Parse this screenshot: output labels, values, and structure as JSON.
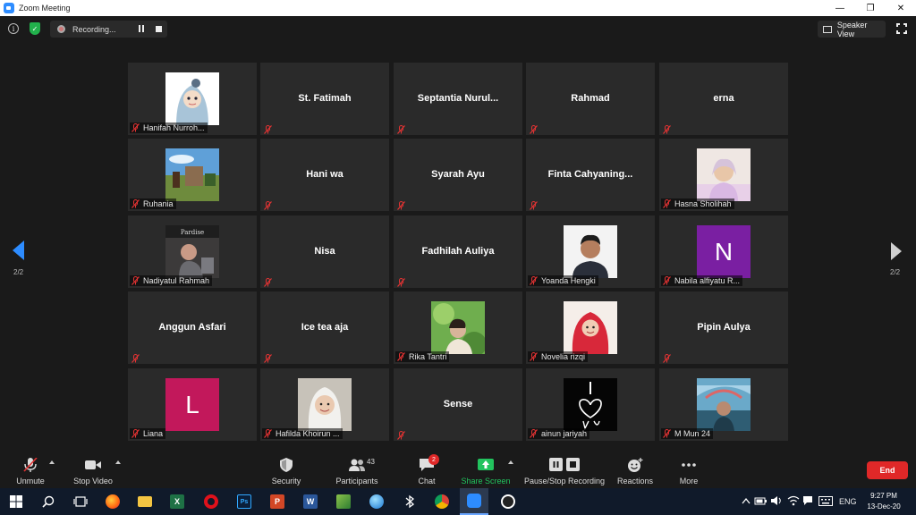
{
  "window": {
    "title": "Zoom Meeting",
    "minimize": "—",
    "restore": "❐",
    "close": "✕"
  },
  "topbar": {
    "info_glyph": "i",
    "recording_label": "Recording...",
    "speaker_view_label": "Speaker View"
  },
  "pagination": {
    "left_label": "2/2",
    "right_label": "2/2"
  },
  "participants": [
    {
      "name": "Hanifah Nurroh...",
      "type": "image",
      "img": "avatar-hijab"
    },
    {
      "name": "St. Fatimah",
      "type": "name"
    },
    {
      "name": "Septantia  Nurul...",
      "type": "name"
    },
    {
      "name": "Rahmad",
      "type": "name"
    },
    {
      "name": "erna",
      "type": "name"
    },
    {
      "name": "Ruhania",
      "type": "image",
      "img": "landscape"
    },
    {
      "name": "Hani wa",
      "type": "name"
    },
    {
      "name": "Syarah Ayu",
      "type": "name"
    },
    {
      "name": "Finta  Cahyaning...",
      "type": "name"
    },
    {
      "name": "Hasna Sholihah",
      "type": "image",
      "img": "portrait-light"
    },
    {
      "name": "Nadiyatul Rahmah",
      "type": "image",
      "img": "portrait-dark"
    },
    {
      "name": "Nisa",
      "type": "name"
    },
    {
      "name": "Fadhilah Auliya",
      "type": "name"
    },
    {
      "name": "Yoanda Hengki",
      "type": "image",
      "img": "portrait-man"
    },
    {
      "name": "Nabila alfiyatu R...",
      "type": "letter",
      "letter": "N",
      "color": "#7a1fa2"
    },
    {
      "name": "Anggun Asfari",
      "type": "name"
    },
    {
      "name": "Ice tea aja",
      "type": "name"
    },
    {
      "name": "Rika Tantri",
      "type": "image",
      "img": "portrait-green"
    },
    {
      "name": "Novelia rizqi",
      "type": "image",
      "img": "portrait-hijab-red"
    },
    {
      "name": "Pipin Aulya",
      "type": "name"
    },
    {
      "name": "Liana",
      "type": "letter",
      "letter": "L",
      "color": "#c2185b"
    },
    {
      "name": "Hafilda Khoirun ...",
      "type": "image",
      "img": "portrait-hijab-white"
    },
    {
      "name": "Sense",
      "type": "name"
    },
    {
      "name": "ainun jariyah",
      "type": "image",
      "img": "dark-art"
    },
    {
      "name": "M Mun 24",
      "type": "image",
      "img": "crowd"
    }
  ],
  "toolbar": {
    "unmute_label": "Unmute",
    "stop_video_label": "Stop Video",
    "security_label": "Security",
    "participants_label": "Participants",
    "participants_count": "43",
    "chat_label": "Chat",
    "chat_badge": "2",
    "share_screen_label": "Share Screen",
    "recording_label": "Pause/Stop Recording",
    "reactions_label": "Reactions",
    "more_label": "More",
    "end_label": "End"
  },
  "taskbar": {
    "language": "ENG",
    "time": "9:27 PM",
    "date": "13-Dec-20"
  },
  "colors": {
    "share_green": "#22c35e",
    "end_red": "#e02828",
    "arrow_blue": "#2d8cff",
    "mute_red": "#e33333"
  }
}
